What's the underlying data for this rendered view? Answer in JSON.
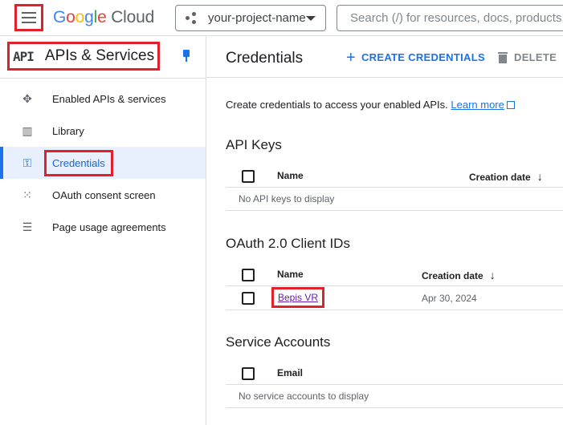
{
  "topbar": {
    "logo_letters": [
      "G",
      "o",
      "o",
      "g",
      "l",
      "e"
    ],
    "logo_product": "Cloud",
    "project_name": "your-project-name",
    "search_placeholder": "Search (/) for resources, docs, products, and more"
  },
  "sidebar": {
    "icon_text": "API",
    "title": "APIs & Services",
    "items": [
      {
        "label": "Enabled APIs & services",
        "icon": "api-diamond-icon"
      },
      {
        "label": "Library",
        "icon": "library-icon"
      },
      {
        "label": "Credentials",
        "icon": "key-icon",
        "active": true
      },
      {
        "label": "OAuth consent screen",
        "icon": "oauth-dots-icon"
      },
      {
        "label": "Page usage agreements",
        "icon": "settings-list-icon"
      }
    ]
  },
  "main": {
    "title": "Credentials",
    "create_label": "CREATE CREDENTIALS",
    "delete_label": "DELETE",
    "intro_text": "Create credentials to access your enabled APIs.",
    "learn_more": "Learn more",
    "api_keys": {
      "title": "API Keys",
      "headers": [
        "Name",
        "Creation date"
      ],
      "empty": "No API keys to display"
    },
    "oauth": {
      "title": "OAuth 2.0 Client IDs",
      "headers": [
        "Name",
        "Creation date"
      ],
      "rows": [
        {
          "name": "Bepis VR",
          "date": "Apr 30, 2024"
        }
      ]
    },
    "service_accounts": {
      "title": "Service Accounts",
      "headers": [
        "Email"
      ],
      "empty": "No service accounts to display"
    }
  },
  "colors": {
    "accent": "#1a73e8",
    "highlight_box": "#e0202a",
    "active_bg": "#e8f0fe"
  }
}
